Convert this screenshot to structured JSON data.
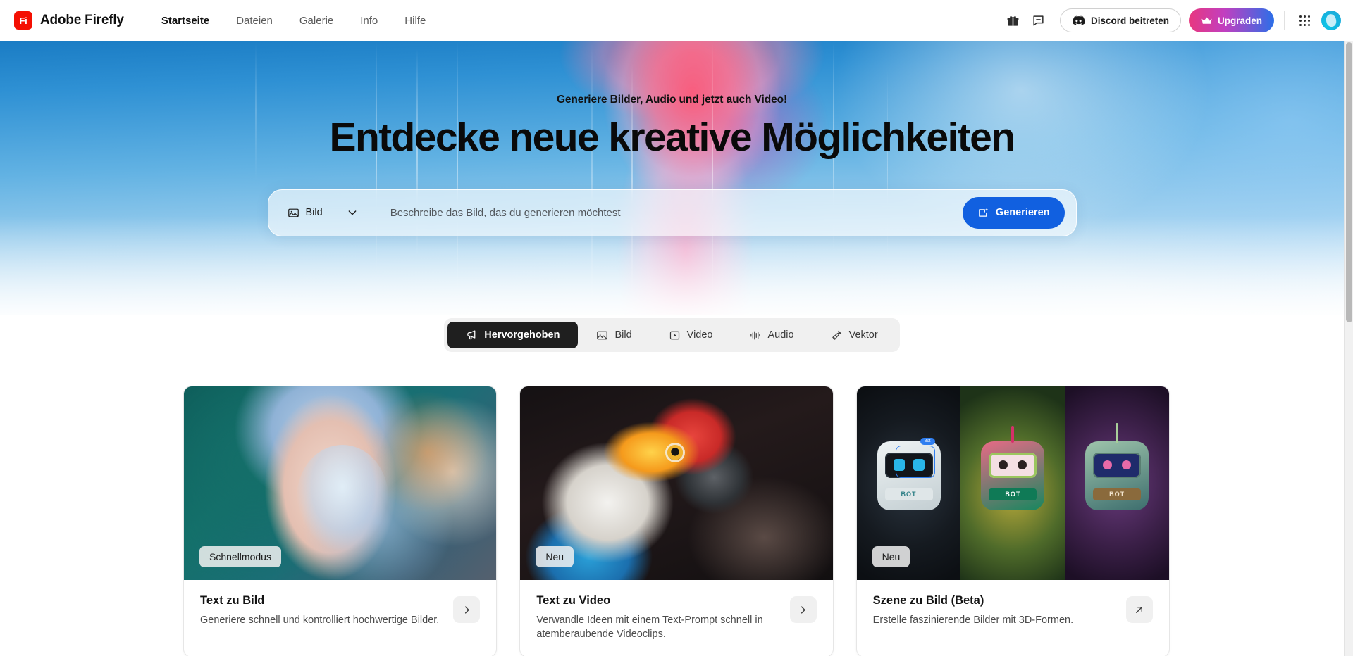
{
  "header": {
    "brand_logo_text": "Fi",
    "brand_name": "Adobe Firefly",
    "brand_color": "#f40f02",
    "nav": [
      {
        "label": "Startseite",
        "active": true
      },
      {
        "label": "Dateien",
        "active": false
      },
      {
        "label": "Galerie",
        "active": false
      },
      {
        "label": "Info",
        "active": false
      },
      {
        "label": "Hilfe",
        "active": false
      }
    ],
    "icons": {
      "gift": "gift-icon",
      "feedback": "speech-bubble-icon",
      "apps": "app-grid-icon",
      "avatar": "user-avatar"
    },
    "discord_label": "Discord beitreten",
    "upgrade_label": "Upgraden",
    "upgrade_gradient_from": "#e8377f",
    "upgrade_gradient_to": "#2b6fe8"
  },
  "hero": {
    "kicker": "Generiere Bilder, Audio und jetzt auch Video!",
    "title": "Entdecke neue kreative Möglichkeiten",
    "prompt": {
      "type_label": "Bild",
      "type_icon": "image-icon",
      "placeholder": "Beschreibe das Bild, das du generieren möchtest",
      "value": "",
      "generate_label": "Generieren",
      "generate_color": "#1160e0"
    }
  },
  "tabs": [
    {
      "label": "Hervorgehoben",
      "icon": "megaphone-icon",
      "active": true
    },
    {
      "label": "Bild",
      "icon": "image-icon",
      "active": false
    },
    {
      "label": "Video",
      "icon": "play-square-icon",
      "active": false
    },
    {
      "label": "Audio",
      "icon": "waveform-icon",
      "active": false
    },
    {
      "label": "Vektor",
      "icon": "pen-icon",
      "active": false
    }
  ],
  "cards": [
    {
      "badge": "Schnellmodus",
      "title": "Text zu Bild",
      "desc": "Generiere schnell und kontrolliert hochwertige Bilder.",
      "action_icon": "chevron-right-icon"
    },
    {
      "badge": "Neu",
      "title": "Text zu Video",
      "desc": "Verwandle Ideen mit einem Text-Prompt schnell in atemberaubende Videoclips.",
      "action_icon": "chevron-right-icon"
    },
    {
      "badge": "Neu",
      "title": "Szene zu Bild (Beta)",
      "desc": "Erstelle faszinierende Bilder mit 3D-Formen.",
      "action_icon": "external-link-icon"
    }
  ],
  "card_art": {
    "bot_label_1": "BOT",
    "bot_label_2": "BOT",
    "bot_label_3": "BOT",
    "sel_tag": "Bot"
  }
}
